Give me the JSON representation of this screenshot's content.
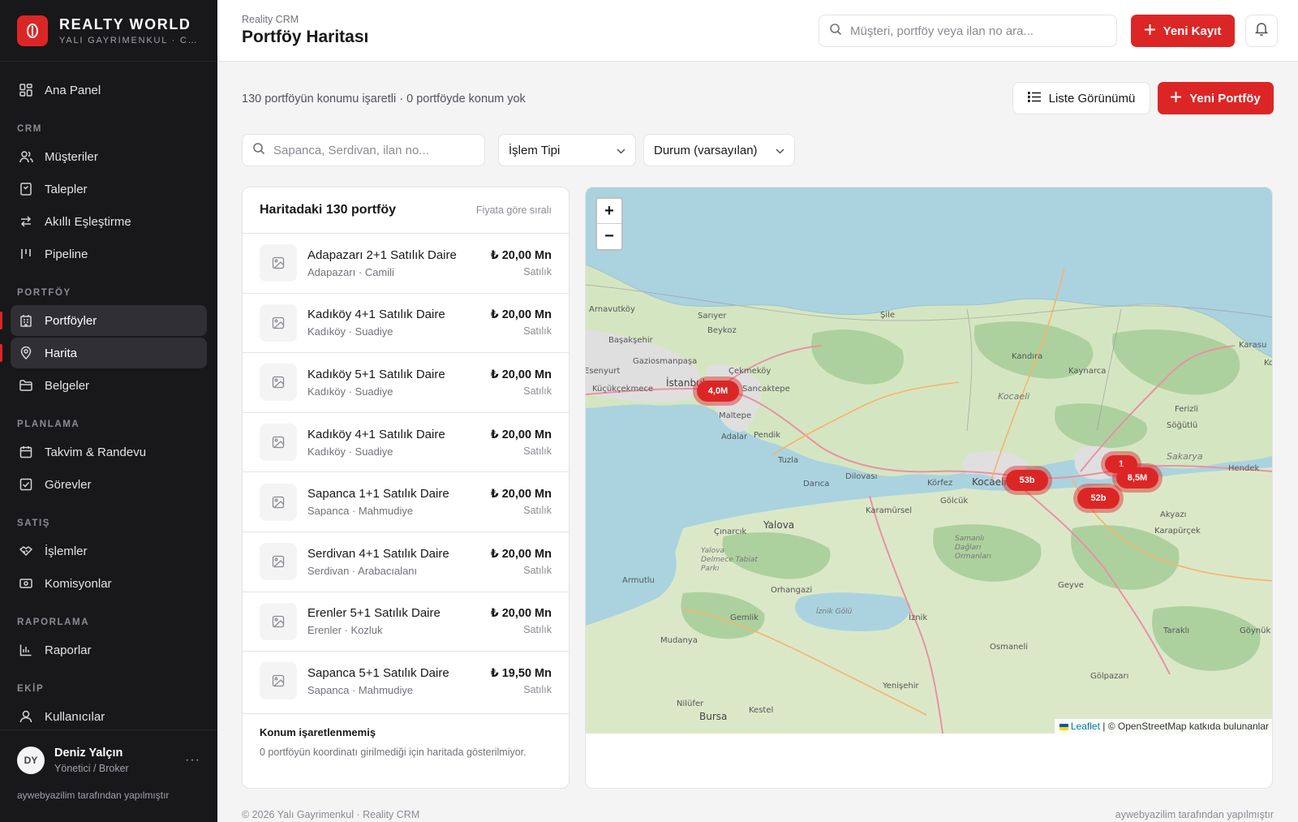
{
  "brand": {
    "name": "REALTY WORLD",
    "subtitle": "YALI GAYRİMENKUL · CRM"
  },
  "sidebar": {
    "dashboard": "Ana Panel",
    "sections": [
      {
        "title": "CRM",
        "items": [
          "Müşteriler",
          "Talepler",
          "Akıllı Eşleştirme",
          "Pipeline"
        ]
      },
      {
        "title": "PORTFÖY",
        "items": [
          "Portföyler",
          "Harita",
          "Belgeler"
        ]
      },
      {
        "title": "PLANLAMA",
        "items": [
          "Takvim & Randevu",
          "Görevler"
        ]
      },
      {
        "title": "SATIŞ",
        "items": [
          "İşlemler",
          "Komisyonlar"
        ]
      },
      {
        "title": "RAPORLAMA",
        "items": [
          "Raporlar"
        ]
      },
      {
        "title": "EKİP",
        "items": [
          "Kullanıcılar"
        ]
      }
    ],
    "active": [
      "Portföyler",
      "Harita"
    ],
    "user": {
      "initials": "DY",
      "name": "Deniz Yalçın",
      "role": "Yönetici / Broker",
      "more": "···"
    },
    "credit": "aywebyazilim tarafından yapılmıştır"
  },
  "header": {
    "breadcrumb": "Reality CRM",
    "title": "Portföy Haritası",
    "search_placeholder": "Müşteri, portföy veya ilan no ara...",
    "new_record": "Yeni Kayıt"
  },
  "toolbar": {
    "summary": "130 portföyün konumu işaretli · 0 portföyde konum yok",
    "list_view": "Liste Görünümü",
    "new_portfolio": "Yeni Portföy"
  },
  "filters": {
    "search_placeholder": "Sapanca, Serdivan, ilan no...",
    "type": "İşlem Tipi",
    "status": "Durum (varsayılan)"
  },
  "list": {
    "title": "Haritadaki 130 portföy",
    "sort": "Fiyata göre sıralı",
    "items": [
      {
        "title": "Adapazarı 2+1 Satılık Daire",
        "location": "Adapazarı · Camili",
        "price": "₺ 20,00 Mn",
        "status": "Satılık"
      },
      {
        "title": "Kadıköy 4+1 Satılık Daire",
        "location": "Kadıköy · Suadiye",
        "price": "₺ 20,00 Mn",
        "status": "Satılık"
      },
      {
        "title": "Kadıköy 5+1 Satılık Daire",
        "location": "Kadıköy · Suadiye",
        "price": "₺ 20,00 Mn",
        "status": "Satılık"
      },
      {
        "title": "Kadıköy 4+1 Satılık Daire",
        "location": "Kadıköy · Suadiye",
        "price": "₺ 20,00 Mn",
        "status": "Satılık"
      },
      {
        "title": "Sapanca 1+1 Satılık Daire",
        "location": "Sapanca · Mahmudiye",
        "price": "₺ 20,00 Mn",
        "status": "Satılık"
      },
      {
        "title": "Serdivan 4+1 Satılık Daire",
        "location": "Serdivan · Arabacıalanı",
        "price": "₺ 20,00 Mn",
        "status": "Satılık"
      },
      {
        "title": "Erenler 5+1 Satılık Daire",
        "location": "Erenler · Kozluk",
        "price": "₺ 20,00 Mn",
        "status": "Satılık"
      },
      {
        "title": "Sapanca 5+1 Satılık Daire",
        "location": "Sapanca · Mahmudiye",
        "price": "₺ 19,50 Mn",
        "status": "Satılık"
      }
    ],
    "footer_title": "Konum işaretlenmemiş",
    "footer_text": "0 portföyün koordinatı girilmediği için haritada gösterilmiyor."
  },
  "map": {
    "zoom_in": "+",
    "zoom_out": "−",
    "attribution_link": "Leaflet",
    "attribution_text": "| © OpenStreetMap katkıda bulunanlar",
    "clusters": [
      "4,0M",
      "53b",
      "8,5M",
      "52b",
      "1"
    ],
    "places": [
      "Arnavutköy",
      "Sarıyer",
      "Beykoz",
      "Başakşehir",
      "Gaziosmanpaşa",
      "Çekmeköy",
      "Esenyurt",
      "Küçükçekmece",
      "İstanbul",
      "Sancaktepe",
      "Maltepe",
      "Pendik",
      "Adalar",
      "Tuzla",
      "Şile",
      "Kandıra",
      "Kaynarca",
      "Kocaeli",
      "Karasu",
      "Ferizli",
      "Söğütlü",
      "Sakarya",
      "Hendek",
      "Darıca",
      "Dilovası",
      "Körfez",
      "Kocaeli",
      "Gölcük",
      "Karamürsel",
      "Çınarcık",
      "Yalova",
      "Yalova Delmece Tabiat Parkı",
      "Armutlu",
      "Samanlı Dağları Ormanları",
      "Orhangazi",
      "Gemlik",
      "İznik Gölü",
      "İznik",
      "Geyve",
      "Akyazı",
      "Karapürçek",
      "Mudanya",
      "Osmaneli",
      "Taraklı",
      "Göynük",
      "Gölpazarı",
      "Yenişehir",
      "Nilüfer",
      "Bursa",
      "Kestel",
      "Ko"
    ]
  },
  "footer": {
    "left": "© 2026 Yalı Gayrimenkul · Reality CRM",
    "right": "aywebyazilim tarafından yapılmıştır"
  }
}
